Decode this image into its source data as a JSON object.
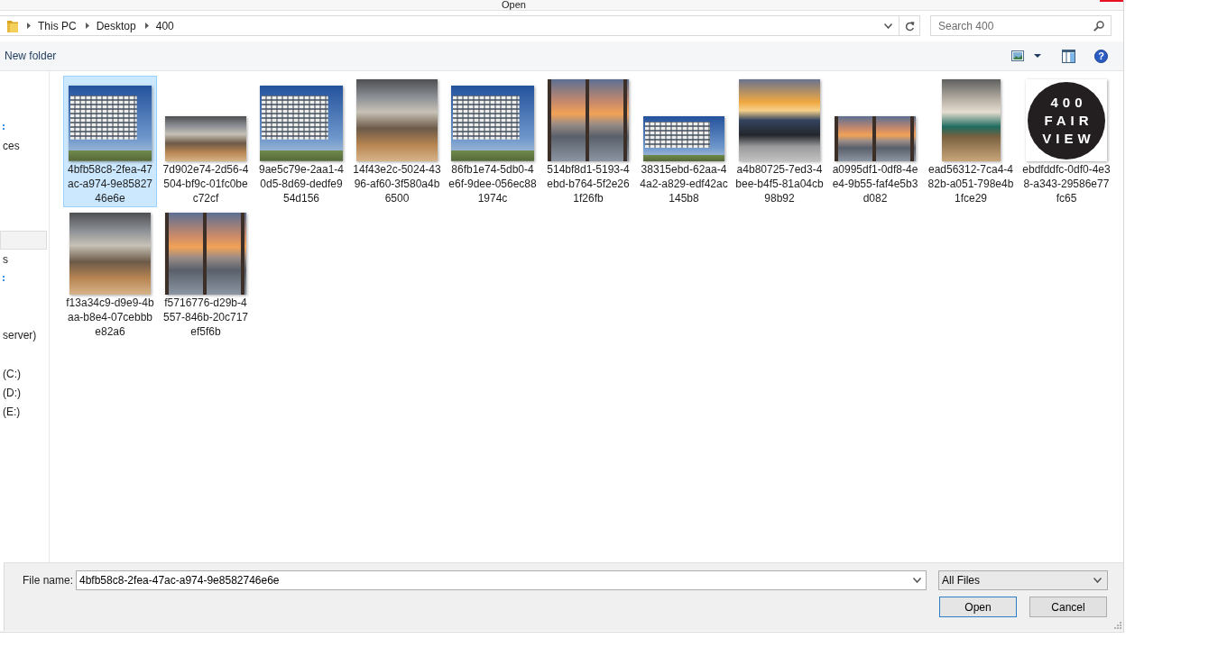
{
  "window": {
    "title": "Open"
  },
  "address_bar": {
    "crumbs": [
      "This PC",
      "Desktop",
      "400"
    ]
  },
  "search": {
    "placeholder": "Search 400"
  },
  "toolbar": {
    "new_folder": "New folder",
    "help": "?"
  },
  "sidebar": {
    "groups": [
      {
        "items": [
          {
            "kind": "mark",
            "selected": false
          },
          {
            "kind": "text",
            "label": "ces",
            "selected": false
          }
        ]
      },
      {
        "items": [
          {
            "kind": "blank",
            "selected": true
          },
          {
            "kind": "text",
            "label": "s",
            "selected": false
          },
          {
            "kind": "mark",
            "selected": false
          }
        ]
      },
      {
        "items": [
          {
            "kind": "text",
            "label": "server)",
            "selected": false
          }
        ]
      },
      {
        "items": [
          {
            "kind": "text",
            "label": "(C:)",
            "selected": false
          },
          {
            "kind": "text",
            "label": "(D:)",
            "selected": false
          },
          {
            "kind": "text",
            "label": "(E:)",
            "selected": false
          }
        ]
      }
    ]
  },
  "files": [
    {
      "name": "4bfb58c8-2fea-47ac-a974-9e8582746e6e",
      "kind": "building",
      "wide": false,
      "selected": true
    },
    {
      "name": "7d902e74-2d56-4504-bf9c-01fc0bec72cf",
      "kind": "interior",
      "wide": true,
      "selected": false
    },
    {
      "name": "9ae5c79e-2aa1-40d5-8d69-dedfe954d156",
      "kind": "building",
      "wide": false,
      "selected": false
    },
    {
      "name": "14f43e2c-5024-4396-af60-3f580a4b6500",
      "kind": "interior",
      "wide": false,
      "selected": false
    },
    {
      "name": "86fb1e74-5db0-4e6f-9dee-056ec881974c",
      "kind": "building",
      "wide": false,
      "selected": false
    },
    {
      "name": "514bf8d1-5193-4ebd-b764-5f2e261f26fb",
      "kind": "sunset",
      "wide": false,
      "selected": false
    },
    {
      "name": "38315ebd-62aa-44a2-a829-edf42ac145b8",
      "kind": "building",
      "wide": true,
      "selected": false
    },
    {
      "name": "a4b80725-7ed3-4bee-b4f5-81a04cb98b92",
      "kind": "rooftop",
      "wide": false,
      "selected": false
    },
    {
      "name": "a0995df1-0df8-4ee4-9b55-faf4e5b3d082",
      "kind": "sunset",
      "wide": true,
      "selected": false
    },
    {
      "name": "ead56312-7ca4-482b-a051-798e4b1fce29",
      "kind": "shop",
      "wide": false,
      "selected": false
    },
    {
      "name": "ebdfddfc-0df0-4e38-a343-29586e77fc65",
      "kind": "logo",
      "wide": false,
      "logo_lines": [
        "400",
        "FAIR",
        "VIEW"
      ],
      "selected": false
    },
    {
      "name": "f13a34c9-d9e9-4baa-b8e4-07cebbbe82a6",
      "kind": "interior",
      "wide": false,
      "selected": false
    },
    {
      "name": "f5716776-d29b-4557-846b-20c717ef5f6b",
      "kind": "sunset",
      "wide": false,
      "selected": false
    }
  ],
  "file_name": {
    "label": "File name:",
    "value": "4bfb58c8-2fea-47ac-a974-9e8582746e6e"
  },
  "file_type": {
    "value": "All Files"
  },
  "buttons": [
    {
      "label": "Open",
      "kind": "default"
    },
    {
      "label": "Cancel",
      "kind": "normal"
    }
  ]
}
